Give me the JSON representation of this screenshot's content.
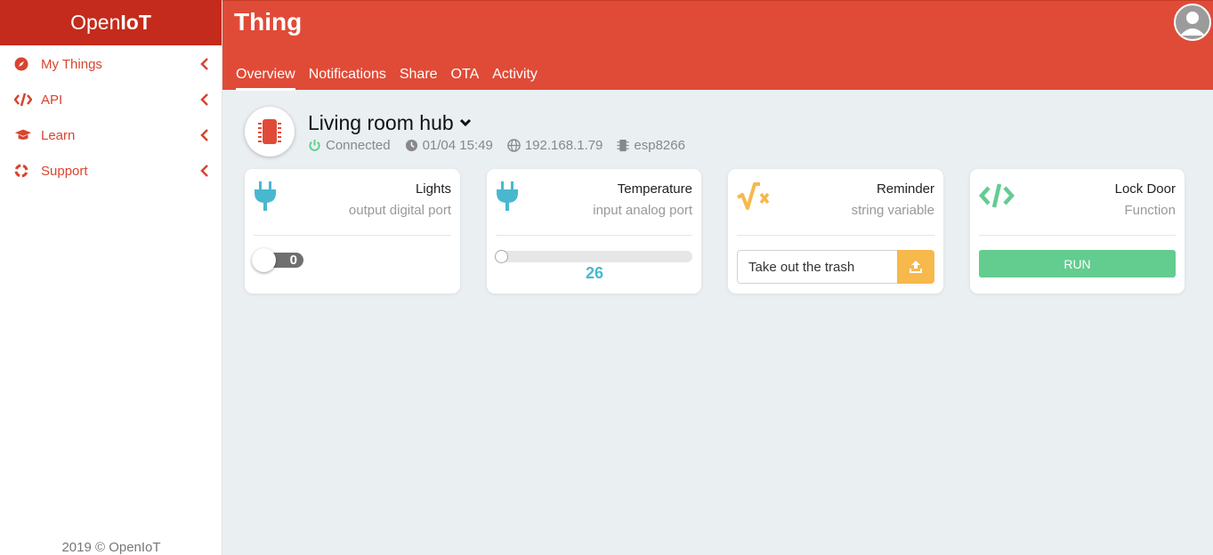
{
  "brand": {
    "prefix": "Open",
    "suffix": "IoT"
  },
  "sidebar": {
    "items": [
      {
        "label": "My Things",
        "icon": "compass-icon"
      },
      {
        "label": "API",
        "icon": "code-icon"
      },
      {
        "label": "Learn",
        "icon": "graduation-cap-icon"
      },
      {
        "label": "Support",
        "icon": "life-ring-icon"
      }
    ],
    "footer": "2019 © OpenIoT"
  },
  "header": {
    "title": "Thing",
    "tabs": [
      "Overview",
      "Notifications",
      "Share",
      "OTA",
      "Activity"
    ],
    "active_tab": "Overview"
  },
  "device": {
    "name": "Living room hub",
    "status": "Connected",
    "last_seen": "01/04 15:49",
    "ip": "192.168.1.79",
    "board": "esp8266"
  },
  "cards": [
    {
      "title": "Lights",
      "subtitle": "output digital port",
      "icon": "plug-icon",
      "value": "0"
    },
    {
      "title": "Temperature",
      "subtitle": "input analog port",
      "icon": "plug-icon",
      "value": "26",
      "level": 0
    },
    {
      "title": "Reminder",
      "subtitle": "string variable",
      "icon": "square-root-icon",
      "input_value": "Take out the trash"
    },
    {
      "title": "Lock Door",
      "subtitle": "Function",
      "icon": "code-icon",
      "button_label": "RUN"
    }
  ],
  "colors": {
    "brand_dark": "#c42b1c",
    "header": "#e04b37",
    "accent_red": "#d8442f",
    "connected_green": "#5ccf8a",
    "plug_blue": "#48b8cf",
    "variable_orange": "#f7b84c",
    "function_green": "#63cc8f"
  }
}
